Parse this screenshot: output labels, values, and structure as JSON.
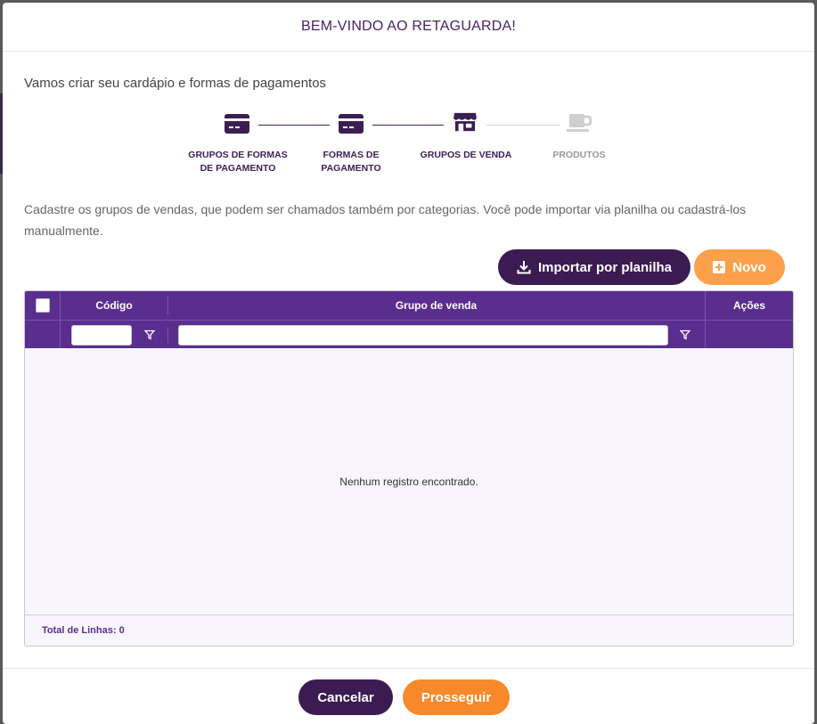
{
  "modal": {
    "title": "BEM-VINDO AO RETAGUARDA!",
    "intro": "Vamos criar seu cardápio e formas de pagamentos"
  },
  "stepper": {
    "steps": [
      {
        "label": "GRUPOS DE FORMAS DE PAGAMENTO",
        "icon": "credit-card-icon",
        "state": "done"
      },
      {
        "label": "FORMAS DE PAGAMENTO",
        "icon": "credit-card-icon",
        "state": "done"
      },
      {
        "label": "GRUPOS DE VENDA",
        "icon": "store-icon",
        "state": "active"
      },
      {
        "label": "PRODUTOS",
        "icon": "coffee-cup-icon",
        "state": "pending"
      }
    ],
    "colors": {
      "active": "#3b1f52",
      "inactive": "#9a9a9a"
    }
  },
  "description": "Cadastre os grupos de vendas, que podem ser chamados também por categorias. Você pode importar via planilha ou cadastrá-los manualmente.",
  "toolbar": {
    "import_label": "Importar por planilha",
    "import_icon": "download-icon",
    "new_label": "Novo",
    "new_icon": "plus-square-icon"
  },
  "grid": {
    "columns": [
      "Código",
      "Grupo de venda",
      "Ações"
    ],
    "filters": {
      "codigo_value": "",
      "grupo_value": ""
    },
    "empty_message": "Nenhum registro encontrado.",
    "footer_label": "Total de Linhas: 0",
    "header_color": "#5a2e8f"
  },
  "footer": {
    "cancel_label": "Cancelar",
    "next_label": "Prosseguir"
  }
}
